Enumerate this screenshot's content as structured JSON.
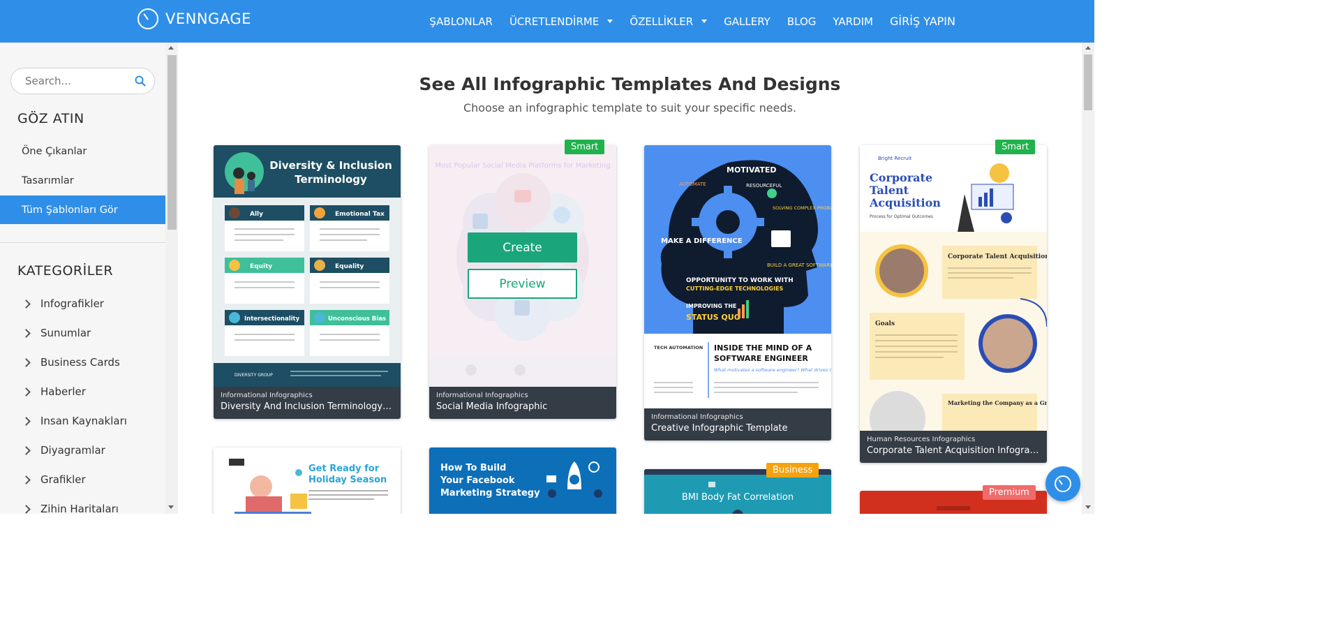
{
  "brand": {
    "name": "VENNGAGE"
  },
  "nav": {
    "items": [
      {
        "label": "ŞABLONLAR",
        "dropdown": false
      },
      {
        "label": "ÜCRETLENDİRME",
        "dropdown": true
      },
      {
        "label": "ÖZELLİKLER",
        "dropdown": true
      },
      {
        "label": "GALLERY",
        "dropdown": false
      },
      {
        "label": "BLOG",
        "dropdown": false
      },
      {
        "label": "YARDIM",
        "dropdown": false
      }
    ],
    "login": "GİRİŞ YAPIN"
  },
  "sidebar": {
    "search_placeholder": "Search...",
    "explore_title": "GÖZ ATIN",
    "explore_links": [
      {
        "label": "Öne Çıkanlar",
        "active": false
      },
      {
        "label": "Tasarımlar",
        "active": false
      },
      {
        "label": "Tüm Şablonları Gör",
        "active": true
      }
    ],
    "categories_title": "KATEGORİLER",
    "categories": [
      "Infografikler",
      "Sunumlar",
      "Business Cards",
      "Haberler",
      "Insan Kaynakları",
      "Diyagramlar",
      "Grafikler",
      "Zihin Haritaları"
    ]
  },
  "main": {
    "heading": "See All Infographic Templates And Designs",
    "subheading": "Choose an infographic template to suit your specific needs.",
    "hover_actions": {
      "create": "Create",
      "preview": "Preview"
    },
    "cards": [
      {
        "category": "Informational Infographics",
        "title": "Diversity And Inclusion Terminology Infog...",
        "badge": ""
      },
      {
        "category": "Informational Infographics",
        "title": "Social Media Infographic",
        "badge": "Smart"
      },
      {
        "category": "Informational Infographics",
        "title": "Creative Infographic Template",
        "badge": ""
      },
      {
        "category": "Human Resources Infographics",
        "title": "Corporate Talent Acquisition Infographic",
        "badge": "Smart"
      }
    ],
    "row2_badges": {
      "business": "Business",
      "premium": "Premium"
    },
    "thumbnails": {
      "diversity": {
        "title_line1": "Diversity & Inclusion",
        "title_line2": "Terminology",
        "terms": [
          "Ally",
          "Emotional Tax",
          "Equity",
          "Equality",
          "Intersectionality",
          "Unconscious Bias"
        ],
        "footer": "DIVERSITY GROUP"
      },
      "social": {
        "title": "Most Popular Social Media Platforms for Marketing"
      },
      "engineer": {
        "words": [
          "MOTIVATED",
          "AUTOMATE",
          "RESOURCEFUL",
          "SOLVING COMPLEX PROBLEMS",
          "MAKE A DIFFERENCE",
          "BUILD A GREAT SOFTWARE",
          "OPPORTUNITY TO WORK WITH",
          "CUTTING-EDGE TECHNOLOGIES",
          "IMPROVING THE",
          "STATUS QUO"
        ],
        "brand": "TECH AUTOMATION",
        "headline_line1": "INSIDE THE MIND OF A",
        "headline_line2": "SOFTWARE ENGINEER",
        "question": "What motivates a software engineer? What drives them to do their best work?"
      },
      "talent": {
        "brand": "Bright Recruit",
        "title_line1": "Corporate",
        "title_line2": "Talent",
        "title_line3": "Acquisition",
        "subtitle": "Process for Optimal Outcomes",
        "sections": [
          "Corporate Talent Acquisition",
          "Goals",
          "Marketing the Company as a Great Place to Work"
        ]
      },
      "holiday": {
        "line1": "Get Ready for",
        "line2": "Holiday Season"
      },
      "facebook": {
        "line1": "How To Build",
        "line2": "Your Facebook",
        "line3": "Marketing Strategy"
      },
      "bmi": {
        "title": "BMI Body Fat Correlation"
      }
    }
  },
  "colors": {
    "primary": "#2f8fe8",
    "create": "#1aa57a",
    "smart": "#21b14d",
    "business": "#f5a20f",
    "premium": "#ef6b6b",
    "caption": "#343c46"
  }
}
